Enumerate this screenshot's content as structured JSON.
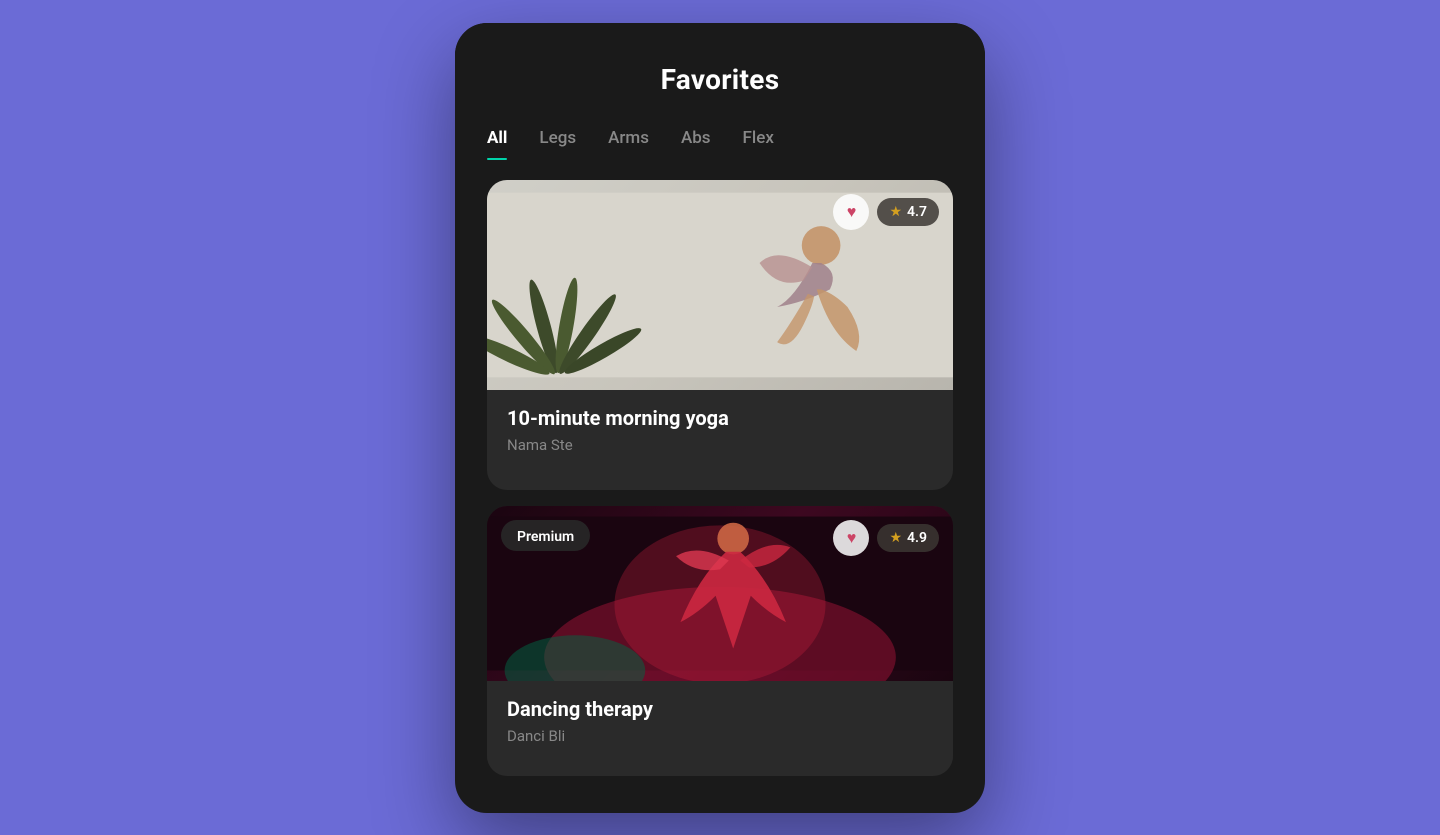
{
  "page": {
    "background_color": "#6B6BD6",
    "title": "Favorites"
  },
  "header": {
    "title": "Favorites"
  },
  "tabs": {
    "items": [
      {
        "id": "all",
        "label": "All",
        "active": true
      },
      {
        "id": "legs",
        "label": "Legs",
        "active": false
      },
      {
        "id": "arms",
        "label": "Arms",
        "active": false
      },
      {
        "id": "abs",
        "label": "Abs",
        "active": false
      },
      {
        "id": "flex",
        "label": "Flex",
        "active": false
      }
    ]
  },
  "cards": [
    {
      "id": "yoga",
      "title": "10-minute morning yoga",
      "subtitle": "Nama Ste",
      "rating": "4.7",
      "liked": true,
      "premium": false,
      "image_type": "yoga"
    },
    {
      "id": "dancing",
      "title": "Dancing therapy",
      "subtitle": "Danci Bli",
      "rating": "4.9",
      "liked": true,
      "premium": true,
      "premium_label": "Premium",
      "image_type": "dancing"
    }
  ],
  "icons": {
    "heart_filled": "♥",
    "star_filled": "★"
  }
}
